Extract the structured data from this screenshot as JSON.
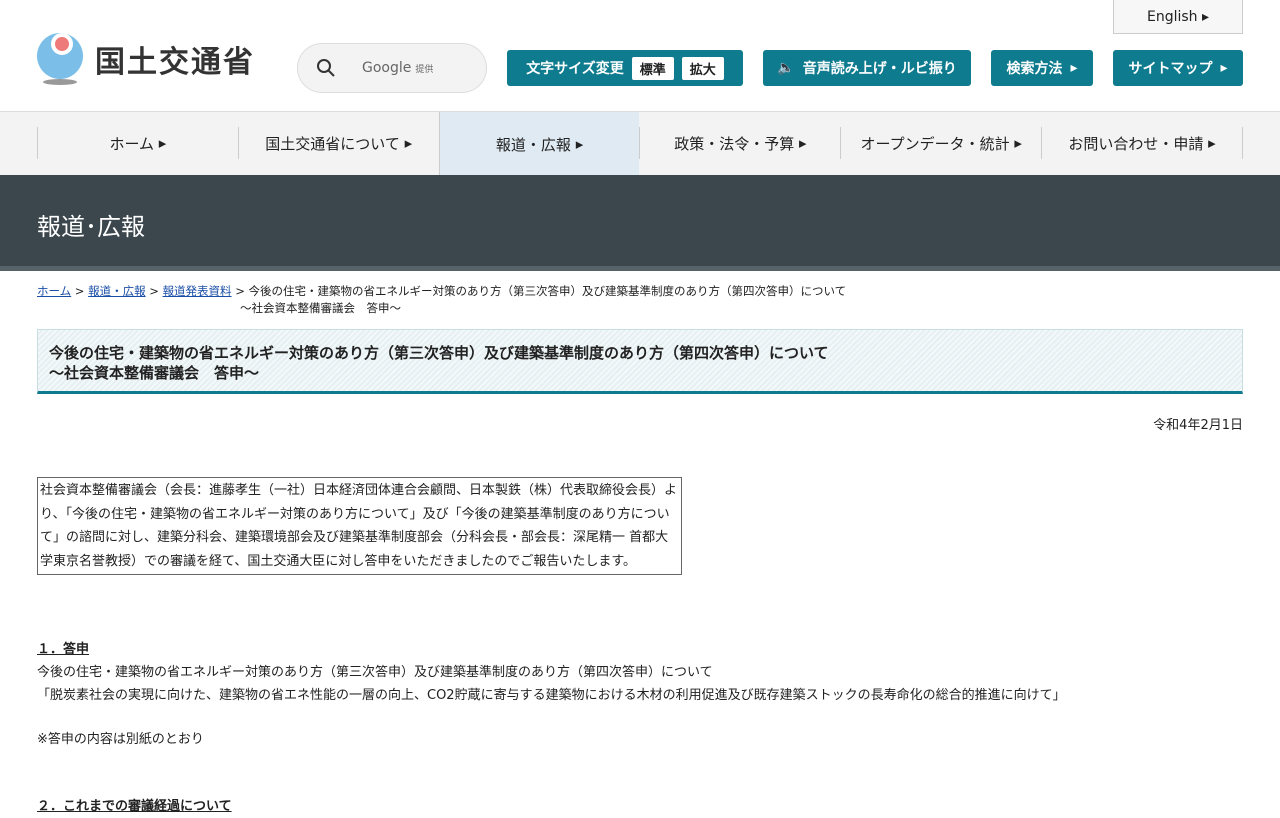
{
  "header": {
    "logo_text": "国土交通省",
    "search_label": "Google",
    "search_sub": "提供",
    "english": "English",
    "font_size": "文字サイズ変更",
    "font_standard": "標準",
    "font_large": "拡大",
    "voice": "音声読み上げ・ルビ振り",
    "search_method": "検索方法",
    "sitemap": "サイトマップ"
  },
  "nav": [
    "ホーム",
    "国土交通省について",
    "報道・広報",
    "政策・法令・予算",
    "オープンデータ・統計",
    "お問い合わせ・申請"
  ],
  "band_title": "報道･広報",
  "breadcrumb": {
    "home": "ホーム",
    "press": "報道・広報",
    "releases": "報道発表資料",
    "current1": "今後の住宅・建築物の省エネルギー対策のあり方（第三次答申）及び建築基準制度のあり方（第四次答申）について",
    "current2": "～社会資本整備審議会　答申～"
  },
  "title1": "今後の住宅・建築物の省エネルギー対策のあり方（第三次答申）及び建築基準制度のあり方（第四次答申）について",
  "title2": "～社会資本整備審議会　答申～",
  "date": "令和4年2月1日",
  "summary": "社会資本整備審議会（会長：進藤孝生（一社）日本経済団体連合会顧問、日本製鉄（株）代表取締役会長）より、「今後の住宅・建築物の省エネルギー対策のあり方について」及び「今後の建築基準制度のあり方について」の諮問に対し、建築分科会、建築環境部会及び建築基準制度部会（分科会長・部会長：深尾精一 首都大学東京名誉教授）での審議を経て、国土交通大臣に対し答申をいただきましたのでご報告いたします。",
  "section1": {
    "heading": "１．答申",
    "line1": "今後の住宅・建築物の省エネルギー対策のあり方（第三次答申）及び建築基準制度のあり方（第四次答申）について",
    "line2": "「脱炭素社会の実現に向けた、建築物の省エネ性能の一層の向上、CO2貯蔵に寄与する建築物における木材の利用促進及び既存建築ストックの長寿命化の総合的推進に向けて」",
    "note": "※答申の内容は別紙のとおり"
  },
  "section2": {
    "heading": "２．これまでの審議経過について"
  }
}
